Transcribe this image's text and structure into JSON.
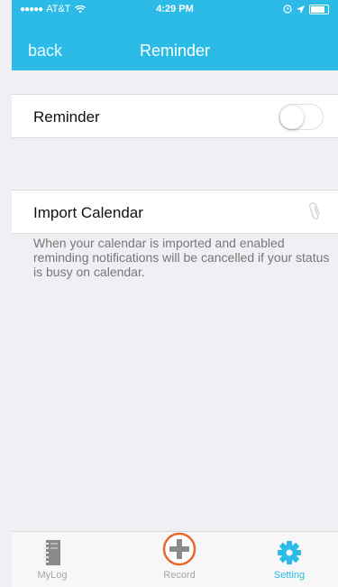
{
  "status_bar": {
    "signal": "●●●●●",
    "carrier": "AT&T",
    "wifi_icon": "wifi-icon",
    "time": "4:29 PM",
    "right_icons": [
      "alarm-icon",
      "location-icon",
      "battery-icon"
    ]
  },
  "nav": {
    "back_label": "back",
    "title": "Reminder"
  },
  "settings": {
    "reminder_label": "Reminder",
    "reminder_enabled": false,
    "import_calendar_label": "Import Calendar",
    "import_calendar_icon": "paperclip-icon",
    "note": "When your calendar is imported and enabled reminding notifications will be cancelled if your status is busy on calendar."
  },
  "tabbar": {
    "tabs": [
      {
        "label": "MyLog",
        "icon": "notebook-icon",
        "active": false
      },
      {
        "label": "Record",
        "icon": "plus-circle-icon",
        "active": false
      },
      {
        "label": "Setting",
        "icon": "gear-icon",
        "active": true
      }
    ]
  },
  "colors": {
    "accent": "#2bbbe6",
    "record_ring": "#e8662b",
    "background": "#efeff4"
  }
}
